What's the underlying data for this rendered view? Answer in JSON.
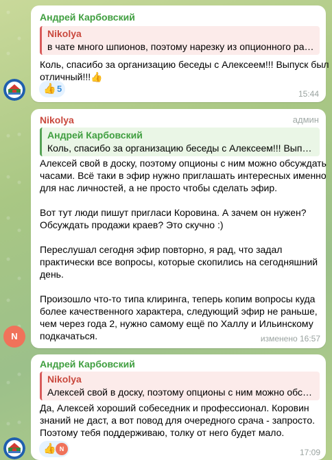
{
  "colors": {
    "sender_green": "#3f9e3f",
    "sender_red": "#c9483d",
    "reply_green_bg": "#eaf6e6",
    "reply_red_bg": "#fcebea",
    "reaction_blue": "#3e8fd8",
    "avatar_n_bg": "#f0725a"
  },
  "messages": [
    {
      "sender": "Андрей Карбовский",
      "reply_name": "Nikolya",
      "reply_text": "в чате много шпионов, поэтому нарезку из опционного рад...",
      "lines": [
        "Коль, спасибо за организацию беседы с Алексеем!!! Выпуск был",
        "отличный!!!👍"
      ],
      "reaction_emoji": "👍",
      "reaction_count": "5",
      "time": "15:44",
      "avatar_icon": "house-logo-icon"
    },
    {
      "sender": "Nikolya",
      "role": "админ",
      "reply_name": "Андрей Карбовский",
      "reply_text": "Коль, спасибо за организацию беседы с Алексеем!!! Выпуск б...",
      "lines": [
        "Алексей свой в доску, поэтому опционы с ним можно обсуждать",
        "часами. Всё таки в эфир нужно приглашать интересных именно",
        "для нас личностей, а не просто чтобы сделать эфир.",
        "",
        "Вот тут люди пишут пригласи Коровина. А зачем он нужен?",
        "Обсуждать продажи краев? Это скучно :)",
        "",
        "Переслушал сегодня эфир повторно, я рад, что задал",
        "практически все вопросы, которые скопились на сегодняшний",
        "день.",
        "",
        "Произошло что-то типа клиринга, теперь копим вопросы куда",
        "более качественного характера, следующий эфир не раньше,",
        "чем через года 2, нужно самому ещё по Халлу и Ильинскому",
        "подкачаться."
      ],
      "time": "изменено 16:57",
      "avatar_letter": "N"
    },
    {
      "sender": "Андрей Карбовский",
      "reply_name": "Nikolya",
      "reply_text": "Алексей свой в доску, поэтому опционы с ним можно обсуж...",
      "lines": [
        "Да, Алексей хороший собеседник и профессионал. Коровин",
        "знаний не даст, а вот повод для очередного срача - запросто.",
        "Поэтому тебя поддерживаю, толку от него будет мало."
      ],
      "reaction_emoji": "👍",
      "reaction_avatar_letter": "N",
      "time": "17:09",
      "avatar_icon": "house-logo-icon"
    }
  ]
}
